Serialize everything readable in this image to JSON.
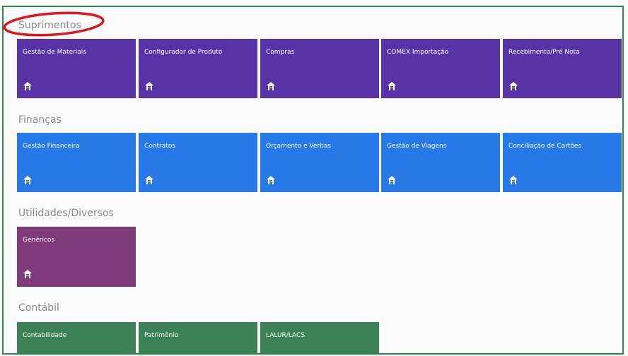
{
  "colors": {
    "suprimentos": "#5733a6",
    "financas": "#2679e6",
    "utilidades": "#803a7b",
    "contabil": "#3c8055",
    "frame_border": "#2f8a46",
    "annotation": "#e0141c"
  },
  "tile_icon": "building-icon",
  "sections": [
    {
      "title": "Suprimentos",
      "tiles": [
        "Gestão de Materiais",
        "Configurador de Produto",
        "Compras",
        "COMEX Importação",
        "Recebimento/Pré Nota"
      ]
    },
    {
      "title": "Finanças",
      "tiles": [
        "Gestão Financeira",
        "Contratos",
        "Orçamento e Verbas",
        "Gestão de Viagens",
        "Conciliação de Cartões"
      ]
    },
    {
      "title": "Utilidades/Diversos",
      "tiles": [
        "Genéricos"
      ]
    },
    {
      "title": "Contábil",
      "tiles": [
        "Contabilidade",
        "Patrimônio",
        "LALUR/LACS"
      ]
    }
  ]
}
